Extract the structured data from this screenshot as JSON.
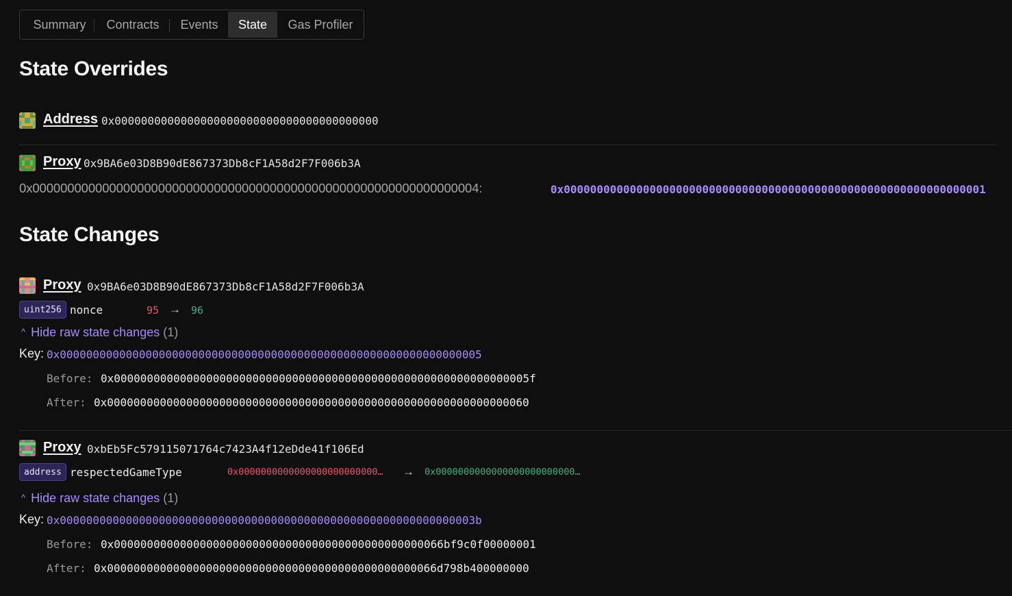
{
  "tabs": [
    {
      "label": "Summary"
    },
    {
      "label": "Contracts"
    },
    {
      "label": "Events"
    },
    {
      "label": "State",
      "active": true
    },
    {
      "label": "Gas Profiler"
    }
  ],
  "overrides": {
    "title": "State Overrides",
    "entries": [
      {
        "name": "Address",
        "address": "0x0000000000000000000000000000000000000000"
      },
      {
        "name": "Proxy",
        "address": "0x9BA6e03D8B90dE867373Db8cF1A58d2F7F006b3A",
        "slot_key": "0x0000000000000000000000000000000000000000000000000000000000000004:",
        "slot_value": "0x0000000000000000000000000000000000000000000000000000000000000001"
      }
    ]
  },
  "changes": {
    "title": "State Changes",
    "entries": [
      {
        "name": "Proxy",
        "address": "0x9BA6e03D8B90dE867373Db8cF1A58d2F7F006b3A",
        "type": "uint256",
        "variable": "nonce",
        "old": "95",
        "new": "96",
        "toggle": "Hide raw state changes",
        "toggle_count": "(1)",
        "key_label": "Key:",
        "key": "0x0000000000000000000000000000000000000000000000000000000000000005",
        "before_label": "Before:",
        "before": "0x000000000000000000000000000000000000000000000000000000000000005f",
        "after_label": "After:",
        "after": "0x0000000000000000000000000000000000000000000000000000000000000060"
      },
      {
        "name": "Proxy",
        "address": "0xbEb5Fc579115071764c7423A4f12eDde41f106Ed",
        "type": "address",
        "variable": "respectedGameType",
        "old": "0x0000000000000000000000000…",
        "new": "0x0000000000000000000000000…",
        "toggle": "Hide raw state changes",
        "toggle_count": "(1)",
        "key_label": "Key:",
        "key": "0x000000000000000000000000000000000000000000000000000000000000003b",
        "before_label": "Before:",
        "before": "0x00000000000000000000000000000000000000000000000066bf9c0f00000001",
        "after_label": "After:",
        "after": "0x00000000000000000000000000000000000000000000000066d798b400000000"
      }
    ]
  },
  "colors": {
    "accent": "#a78bfa",
    "old_value": "#f0506e",
    "new_value": "#3fb27f",
    "background": "#0f0f0f"
  },
  "icons": {
    "chevron": "chevron-up-icon",
    "arrow": "arrow-right-icon",
    "avatar": "identicon-avatar"
  }
}
